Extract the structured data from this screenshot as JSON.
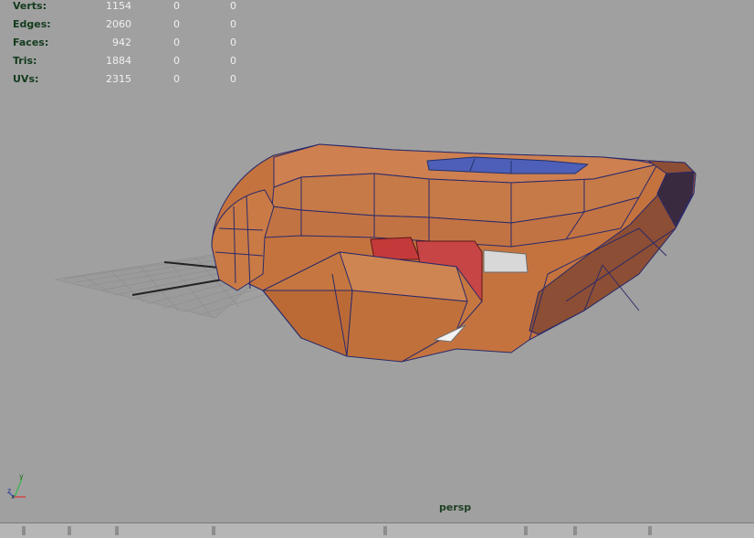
{
  "hud": {
    "rows": [
      {
        "label": "Verts:",
        "v1": "1154",
        "v2": "0",
        "v3": "0"
      },
      {
        "label": "Edges:",
        "v1": "2060",
        "v2": "0",
        "v3": "0"
      },
      {
        "label": "Faces:",
        "v1": "942",
        "v2": "0",
        "v3": "0"
      },
      {
        "label": "Tris:",
        "v1": "1884",
        "v2": "0",
        "v3": "0"
      },
      {
        "label": "UVs:",
        "v1": "2315",
        "v2": "0",
        "v3": "0"
      }
    ]
  },
  "viewport": {
    "camera_label": "persp",
    "background_color": "#a0a0a0",
    "model_color": "#c87a48",
    "wire_color": "#28286a"
  },
  "axis": {
    "y": "y",
    "z": "z",
    "x": "x"
  }
}
